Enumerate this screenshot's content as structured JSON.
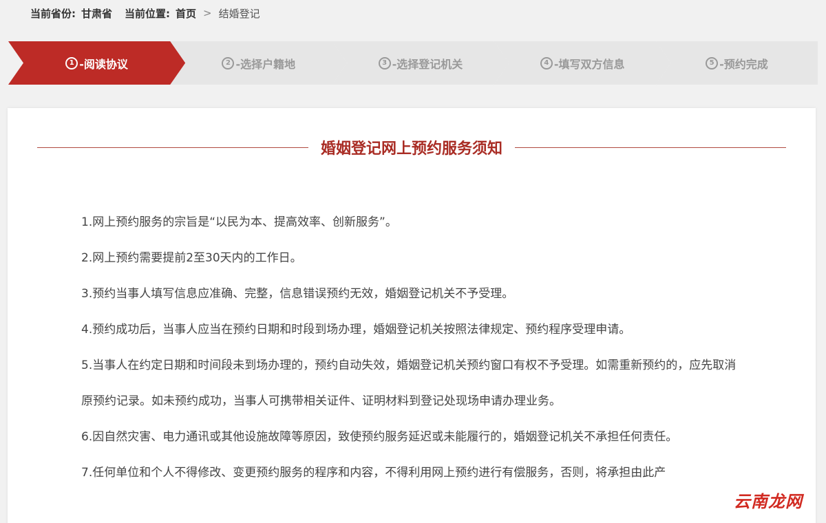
{
  "breadcrumb": {
    "province_label": "当前省份:",
    "province_value": "甘肃省",
    "location_label": "当前位置:",
    "home": "首页",
    "separator": ">",
    "current": "结婚登记"
  },
  "steps": [
    {
      "num": "1",
      "label": "-阅读协议",
      "active": true
    },
    {
      "num": "2",
      "label": "-选择户籍地",
      "active": false
    },
    {
      "num": "3",
      "label": "-选择登记机关",
      "active": false
    },
    {
      "num": "4",
      "label": "-填写双方信息",
      "active": false
    },
    {
      "num": "5",
      "label": "-预约完成",
      "active": false
    }
  ],
  "notice": {
    "title": "婚姻登记网上预约服务须知",
    "items": [
      "1.网上预约服务的宗旨是“以民为本、提高效率、创新服务”。",
      "2.网上预约需要提前2至30天内的工作日。",
      "3.预约当事人填写信息应准确、完整，信息错误预约无效，婚姻登记机关不予受理。",
      "4.预约成功后，当事人应当在预约日期和时段到场办理，婚姻登记机关按照法律规定、预约程序受理申请。",
      "5.当事人在约定日期和时间段未到场办理的，预约自动失效，婚姻登记机关预约窗口有权不予受理。如需重新预约的，应先取消原预约记录。如未预约成功，当事人可携带相关证件、证明材料到登记处现场申请办理业务。",
      "6.因自然灾害、电力通讯或其他设施故障等原因，致使预约服务延迟或未能履行的，婚姻登记机关不承担任何责任。",
      "7.任何单位和个人不得修改、变更预约服务的程序和内容，不得利用网上预约进行有偿服务，否则，将承担由此产"
    ]
  },
  "watermark": "云南龙网",
  "colors": {
    "accent": "#bd2b26",
    "title": "#a92c24",
    "inactive_step": "#e6e6e6"
  }
}
